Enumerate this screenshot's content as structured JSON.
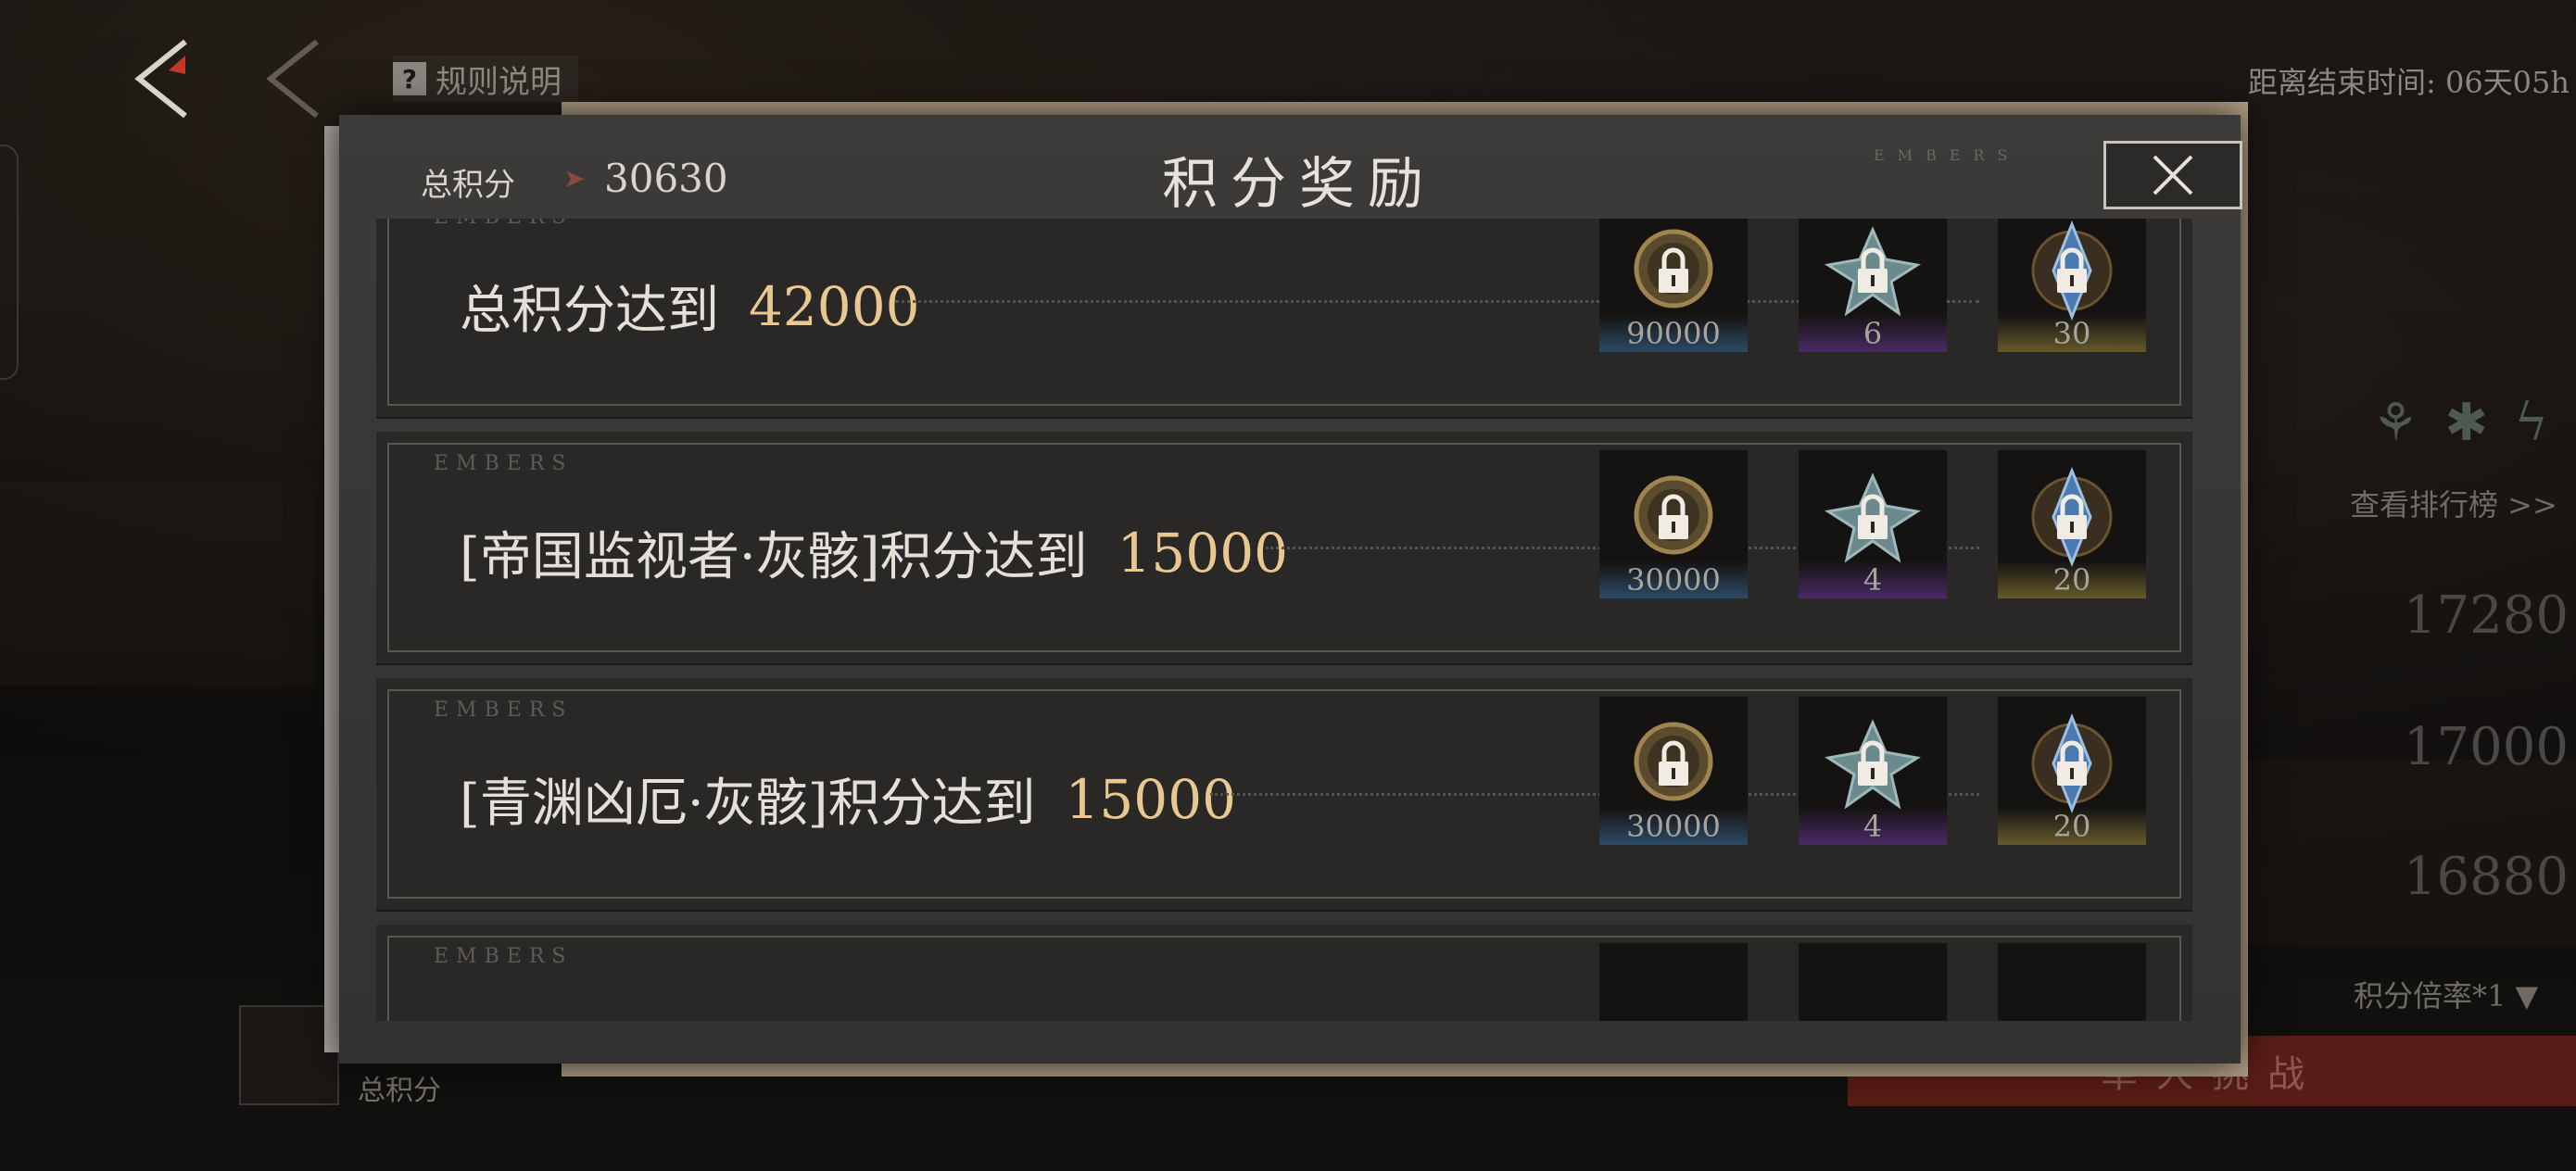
{
  "background": {
    "rules_label": "规则说明",
    "timer_text": "距离结束时间: 06天05h",
    "leaderboard_label": "查看排行榜 >>",
    "ranks": [
      "17280",
      "17000",
      "16880"
    ],
    "multiplier_label": "积分倍率*1 ▼",
    "challenge_label": "单人挑战",
    "chest_label": "总积分"
  },
  "modal": {
    "total_label": "总积分",
    "total_value": "30630",
    "title": "积分奖励",
    "embers_tag": "EMBERS",
    "rows": [
      {
        "label": "总积分达到",
        "score": "42000",
        "rewards": [
          {
            "icon": "coin-icon",
            "qty": "90000",
            "tier_color": "#2c4a66",
            "locked": true
          },
          {
            "icon": "shuriken-icon",
            "qty": "6",
            "tier_color": "#4a2a66",
            "locked": true
          },
          {
            "icon": "crystal-icon",
            "qty": "30",
            "tier_color": "#665a2a",
            "locked": true
          }
        ]
      },
      {
        "label": "[帝国监视者·灰骸]积分达到",
        "score": "15000",
        "rewards": [
          {
            "icon": "coin-icon",
            "qty": "30000",
            "tier_color": "#2c4a66",
            "locked": true
          },
          {
            "icon": "shuriken-icon",
            "qty": "4",
            "tier_color": "#4a2a66",
            "locked": true
          },
          {
            "icon": "crystal-icon",
            "qty": "20",
            "tier_color": "#665a2a",
            "locked": true
          }
        ]
      },
      {
        "label": "[青渊凶厄·灰骸]积分达到",
        "score": "15000",
        "rewards": [
          {
            "icon": "coin-icon",
            "qty": "30000",
            "tier_color": "#2c4a66",
            "locked": true
          },
          {
            "icon": "shuriken-icon",
            "qty": "4",
            "tier_color": "#4a2a66",
            "locked": true
          },
          {
            "icon": "crystal-icon",
            "qty": "20",
            "tier_color": "#665a2a",
            "locked": true
          }
        ]
      }
    ]
  },
  "colors": {
    "score_gold": "#e8c890",
    "accent_red": "#c0392b"
  }
}
